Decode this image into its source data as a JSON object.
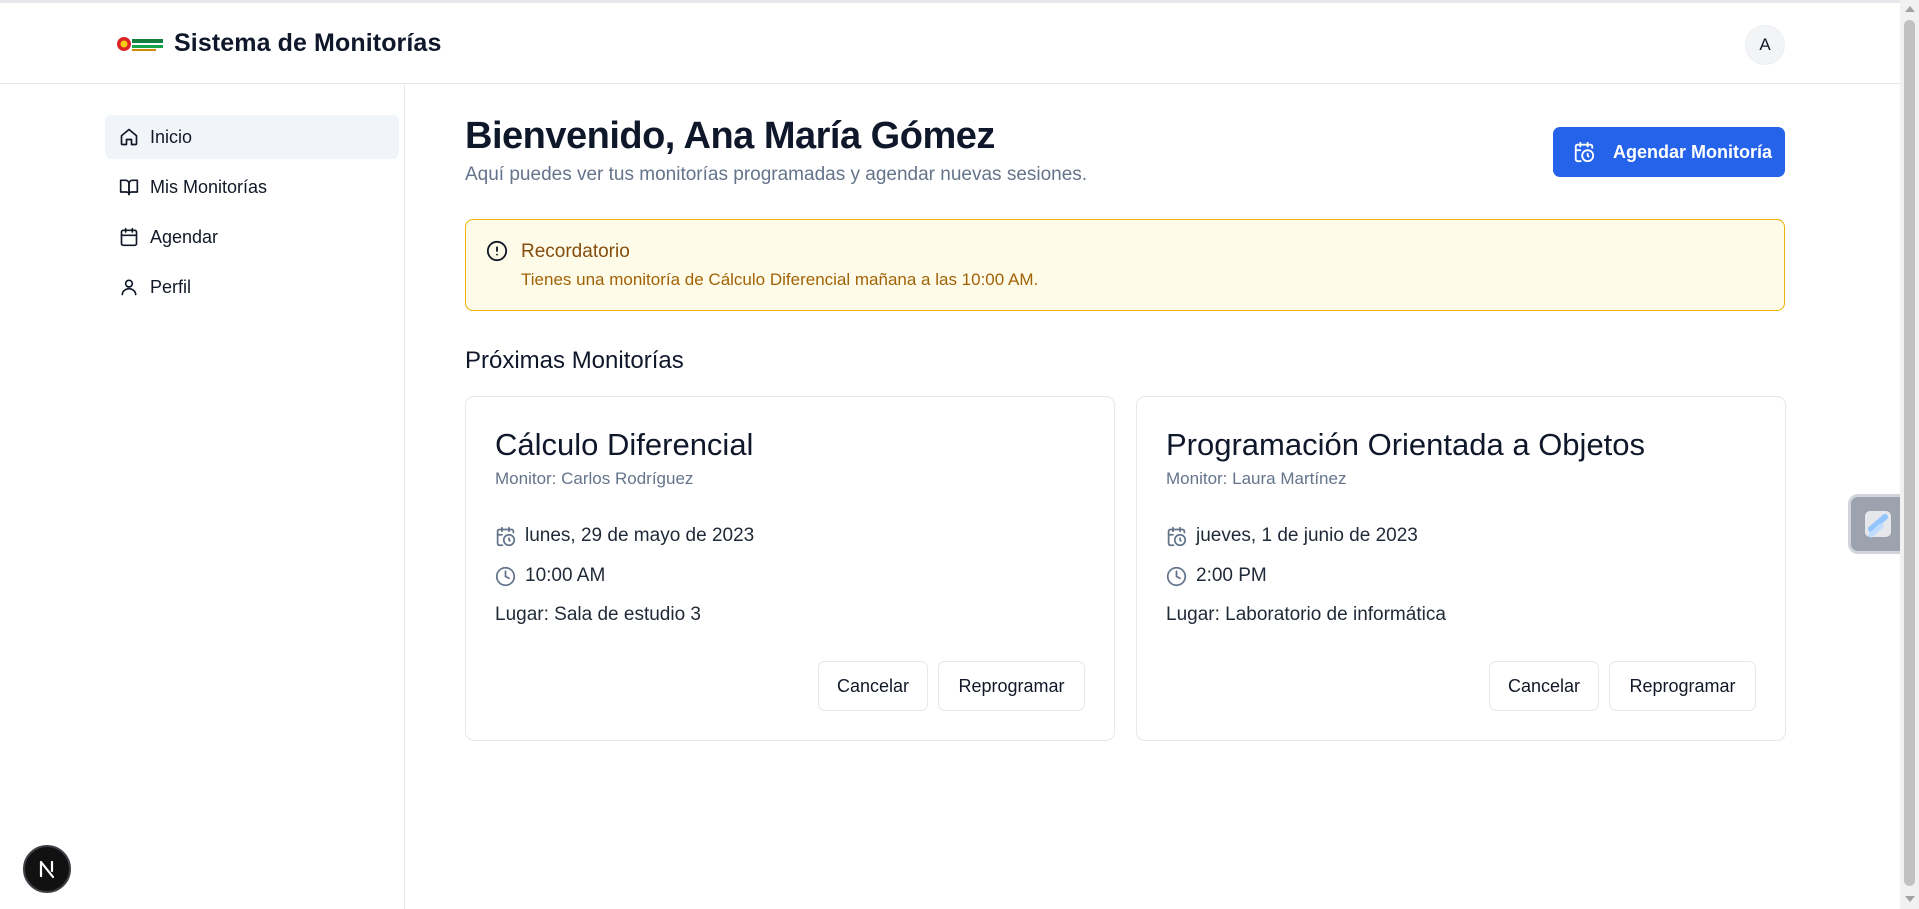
{
  "header": {
    "app_title": "Sistema de Monitorías",
    "avatar_initial": "A"
  },
  "sidebar": {
    "items": [
      {
        "label": "Inicio",
        "icon": "home-icon",
        "active": true
      },
      {
        "label": "Mis Monitorías",
        "icon": "book-icon",
        "active": false
      },
      {
        "label": "Agendar",
        "icon": "calendar-icon",
        "active": false
      },
      {
        "label": "Perfil",
        "icon": "user-icon",
        "active": false
      }
    ]
  },
  "main": {
    "welcome": "Bienvenido, Ana María Gómez",
    "subtitle": "Aquí puedes ver tus monitorías programadas y agendar nuevas sesiones.",
    "schedule_button": "Agendar Monitoría",
    "alert": {
      "title": "Recordatorio",
      "text": "Tienes una monitoría de Cálculo Diferencial mañana a las 10:00 AM."
    },
    "section_title": "Próximas Monitorías",
    "cards": [
      {
        "title": "Cálculo Diferencial",
        "monitor": "Monitor: Carlos Rodríguez",
        "date": "lunes, 29 de mayo de 2023",
        "time": "10:00 AM",
        "place": "Lugar: Sala de estudio 3",
        "cancel": "Cancelar",
        "reschedule": "Reprogramar"
      },
      {
        "title": "Programación Orientada a Objetos",
        "monitor": "Monitor: Laura Martínez",
        "date": "jueves, 1 de junio de 2023",
        "time": "2:00 PM",
        "place": "Lugar: Laboratorio de informática",
        "cancel": "Cancelar",
        "reschedule": "Reprogramar"
      }
    ]
  },
  "colors": {
    "primary": "#2563eb",
    "alert_bg": "#fefce8",
    "alert_border": "#eab308",
    "alert_title": "#854d0e",
    "muted": "#64748b"
  }
}
